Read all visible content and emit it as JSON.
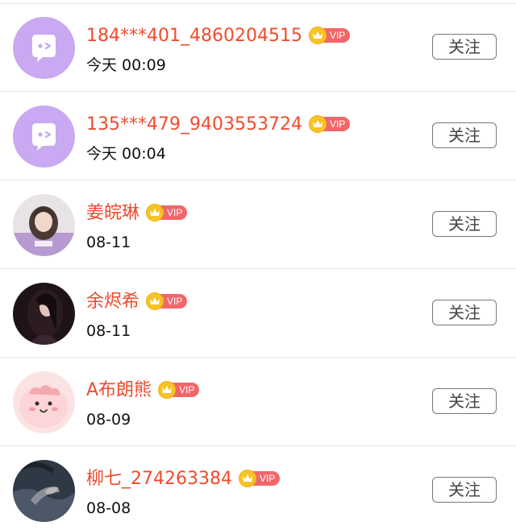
{
  "rows": [
    {
      "name": "184***401_4860204515",
      "time": "今天 00:09",
      "vip": "VIP",
      "follow": "关注",
      "avatar": "default"
    },
    {
      "name": "135***479_9403553724",
      "time": "今天 00:04",
      "vip": "VIP",
      "follow": "关注",
      "avatar": "default"
    },
    {
      "name": "姜皖琳",
      "time": "08-11",
      "vip": "VIP",
      "follow": "关注",
      "avatar": "photo-girl-purple"
    },
    {
      "name": "余烬希",
      "time": "08-11",
      "vip": "VIP",
      "follow": "关注",
      "avatar": "photo-girl-dark"
    },
    {
      "name": "A布朗熊",
      "time": "08-09",
      "vip": "VIP",
      "follow": "关注",
      "avatar": "cartoon-pink"
    },
    {
      "name": "柳七_274263384",
      "time": "08-08",
      "vip": "VIP",
      "follow": "关注",
      "avatar": "photo-hands-dark"
    }
  ],
  "colors": {
    "name": "#f04b2e",
    "vip_tag": "#f2666a",
    "crown": "#f7c325",
    "default_avatar": "#c9a9f1"
  }
}
